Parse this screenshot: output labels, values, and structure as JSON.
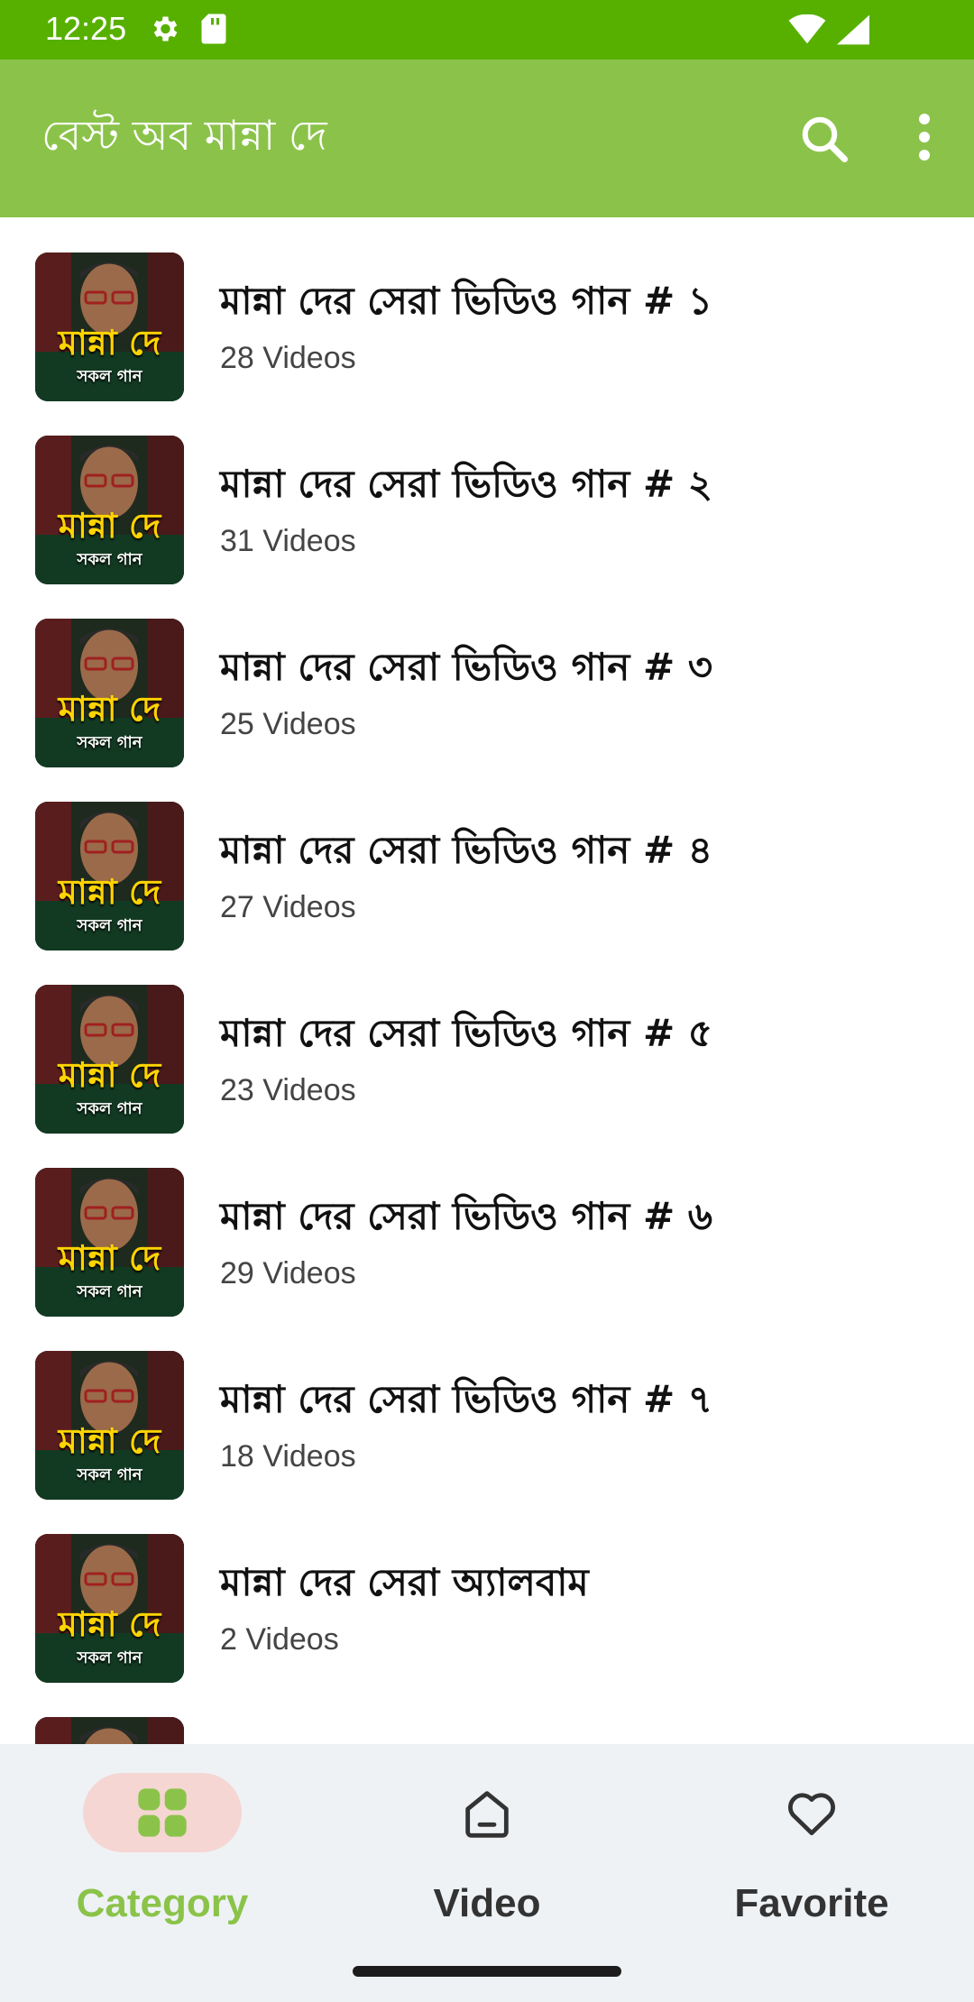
{
  "status_bar": {
    "time": "12:25",
    "icons_left": [
      "settings-icon",
      "sd-card-icon"
    ],
    "icons_right": [
      "wifi-icon",
      "signal-icon"
    ],
    "color": "#57b000"
  },
  "app_bar": {
    "title": "বেস্ট অব মান্না দে",
    "color": "#8bc34a",
    "actions": [
      "search-icon",
      "more-vert-icon"
    ]
  },
  "thumbnail": {
    "title": "মান্না দে",
    "subtitle": "সকল গান"
  },
  "items": [
    {
      "title": "মান্না দের সেরা ভিডিও গান # ১",
      "count": "28 Videos"
    },
    {
      "title": "মান্না দের সেরা ভিডিও গান # ২",
      "count": "31 Videos"
    },
    {
      "title": "মান্না দের সেরা ভিডিও গান # ৩",
      "count": "25 Videos"
    },
    {
      "title": "মান্না দের সেরা ভিডিও গান # ৪",
      "count": "27 Videos"
    },
    {
      "title": "মান্না দের সেরা ভিডিও গান # ৫",
      "count": "23 Videos"
    },
    {
      "title": "মান্না দের সেরা ভিডিও গান # ৬",
      "count": "29 Videos"
    },
    {
      "title": "মান্না দের সেরা ভিডিও গান # ৭",
      "count": "18 Videos"
    },
    {
      "title": "মান্না দের সেরা অ্যালবাম",
      "count": "2 Videos"
    }
  ],
  "bottom_nav": {
    "items": [
      {
        "label": "Category",
        "icon": "grid-icon",
        "active": true
      },
      {
        "label": "Video",
        "icon": "home-icon",
        "active": false
      },
      {
        "label": "Favorite",
        "icon": "heart-icon",
        "active": false
      }
    ],
    "active_color": "#8bc34a",
    "inactive_color": "#333333"
  }
}
